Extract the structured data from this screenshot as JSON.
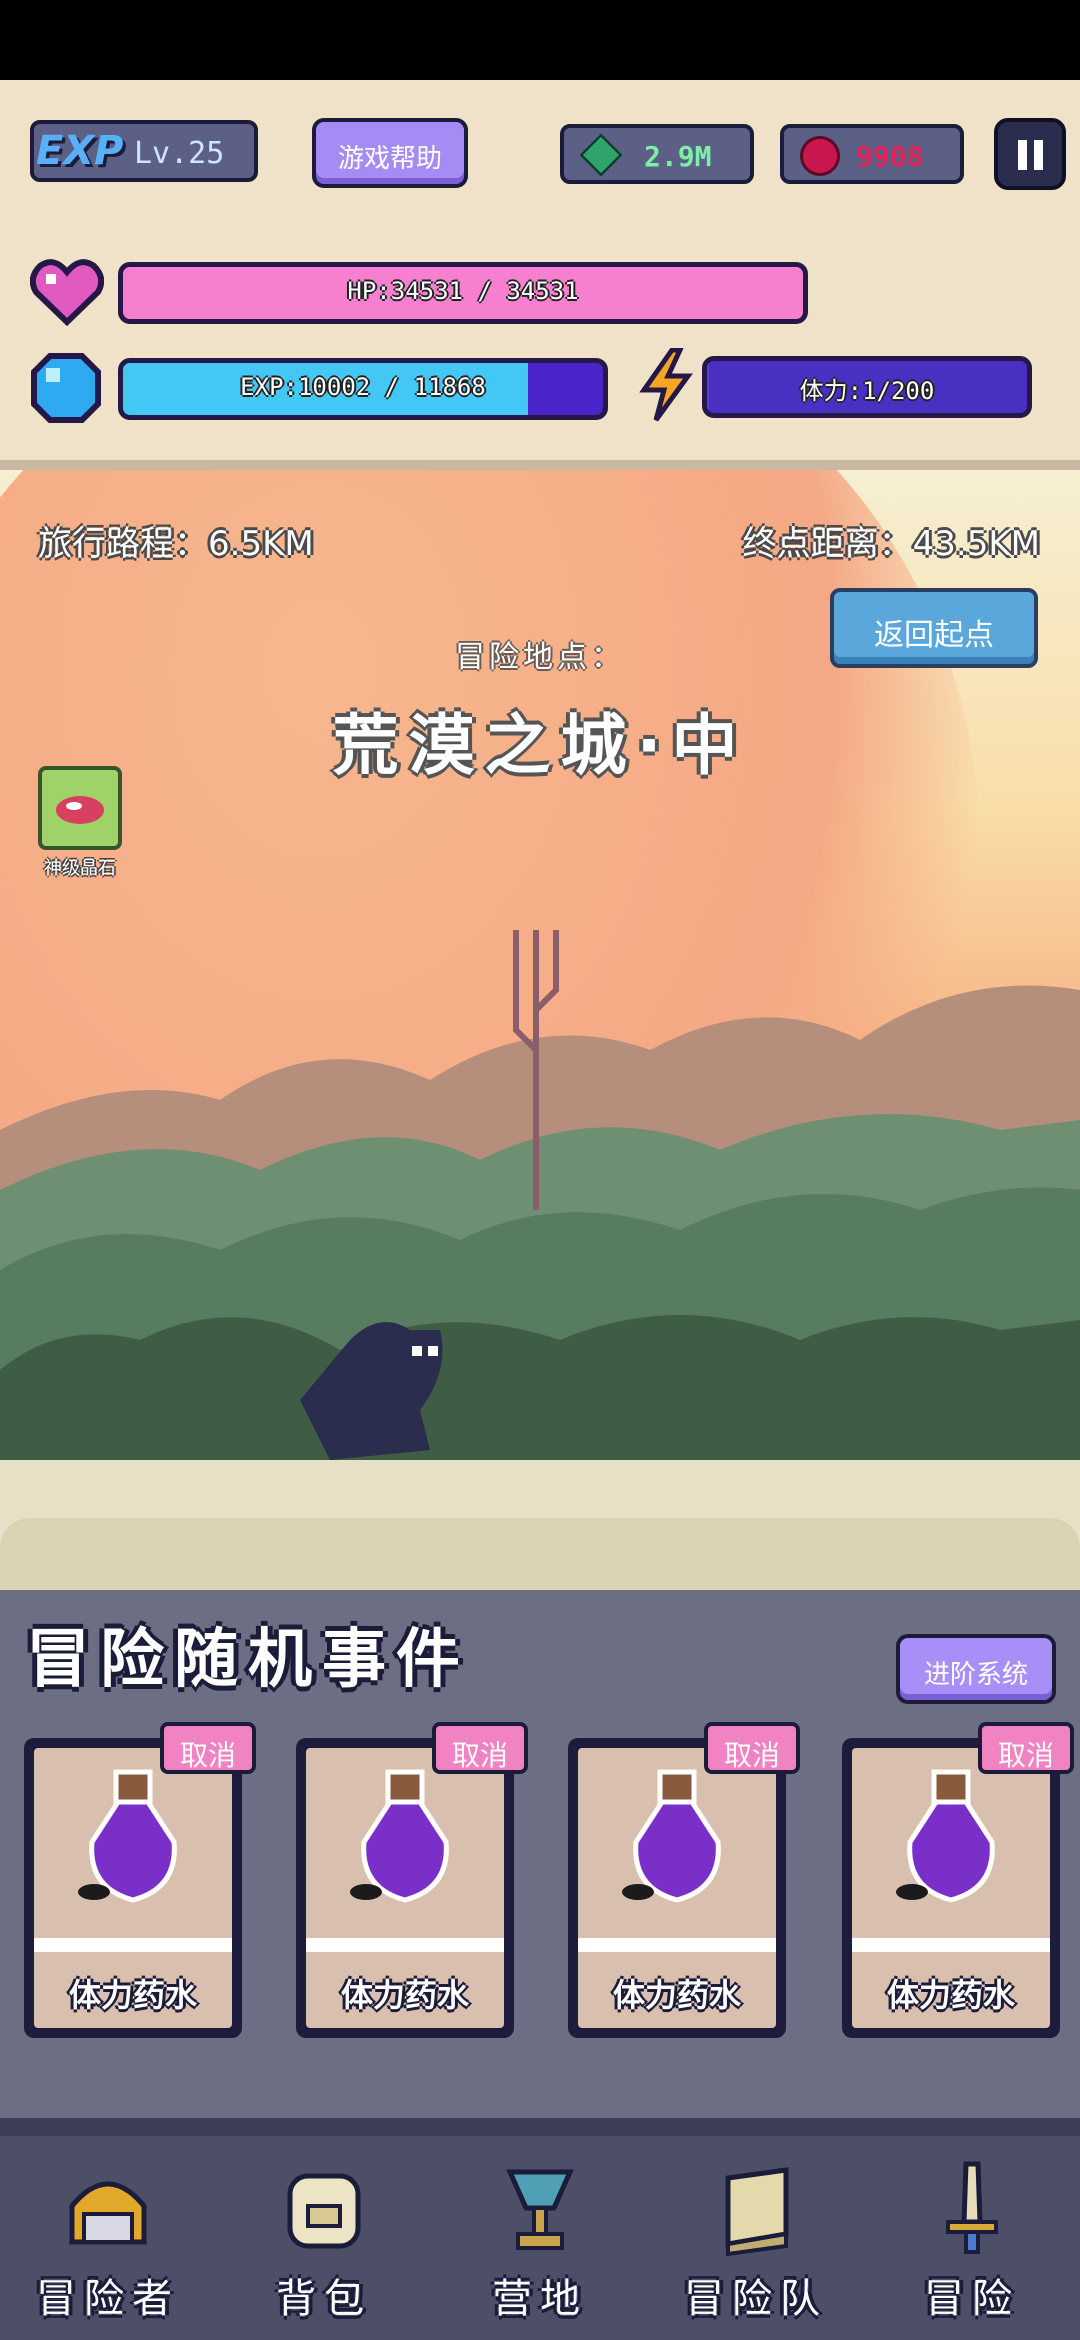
{
  "hud": {
    "exp_logo": "EXP",
    "level": "Lv.25",
    "help_button": "游戏帮助",
    "gems": "2.9M",
    "rubies": "9908",
    "hp_label": "HP:34531 / 34531",
    "hp_fraction": 1.0,
    "exp_label": "EXP:10002 / 11868",
    "exp_fraction": 0.843,
    "stamina_label": "体力:1/200",
    "stamina_fraction": 0.005
  },
  "scene": {
    "trip_traveled": "旅行路程：6.5KM",
    "trip_remaining": "终点距离：43.5KM",
    "return_button": "返回起点",
    "location_label": "冒险地点：",
    "location_name": "荒漠之城·中",
    "buff_label": "神级晶石"
  },
  "events": {
    "title": "冒险随机事件",
    "advance_button": "进阶系统",
    "cards": [
      {
        "name": "体力药水",
        "cancel": "取消"
      },
      {
        "name": "体力药水",
        "cancel": "取消"
      },
      {
        "name": "体力药水",
        "cancel": "取消"
      },
      {
        "name": "体力药水",
        "cancel": "取消"
      }
    ]
  },
  "nav": {
    "items": [
      {
        "label": "冒险者",
        "icon": "helmet-icon"
      },
      {
        "label": "背包",
        "icon": "backpack-icon"
      },
      {
        "label": "营地",
        "icon": "camp-trophy-icon"
      },
      {
        "label": "冒险队",
        "icon": "book-icon"
      },
      {
        "label": "冒险",
        "icon": "sword-icon"
      }
    ]
  }
}
